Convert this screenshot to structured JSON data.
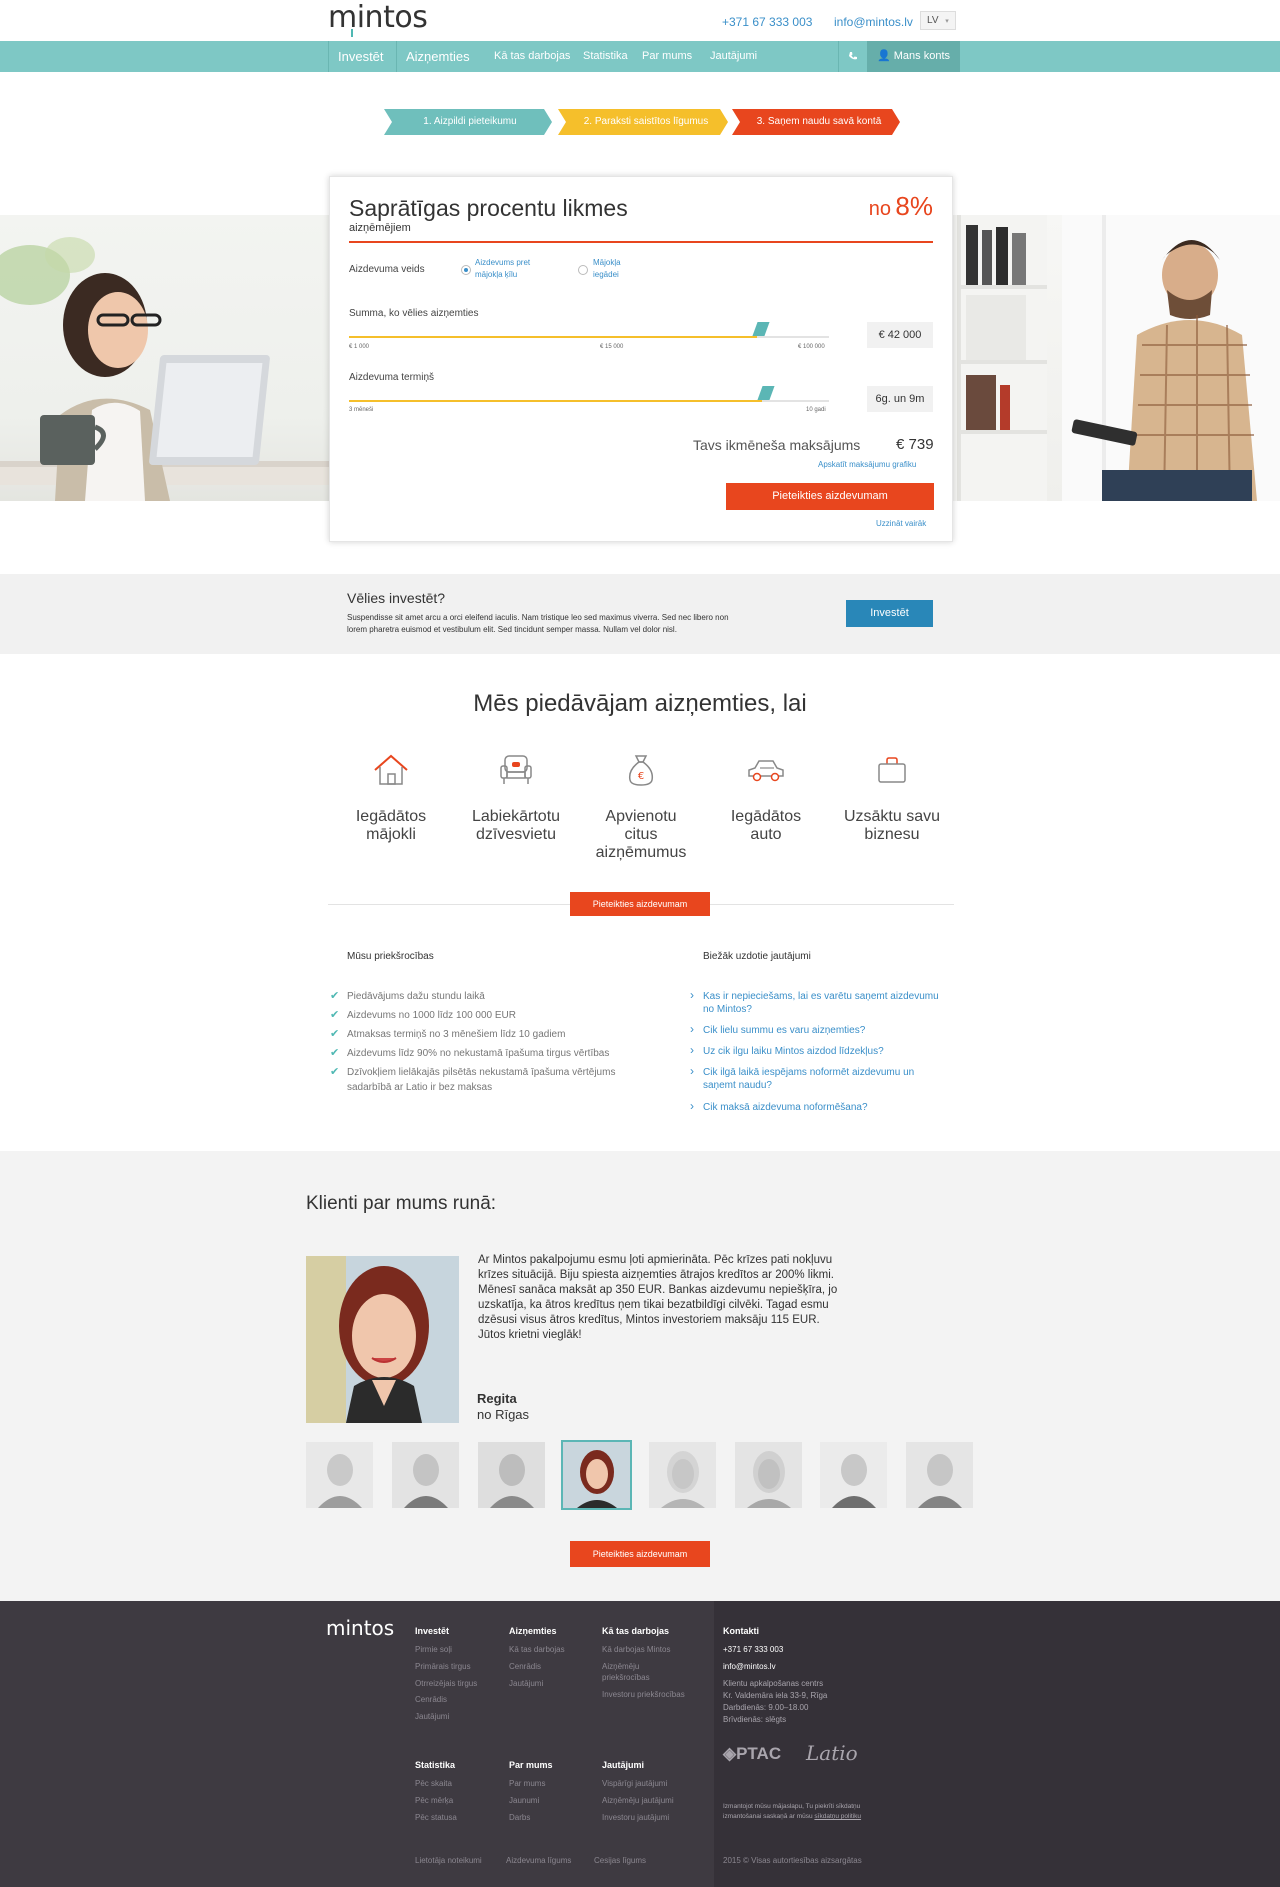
{
  "header": {
    "logo": "mintos",
    "phone": "+371 67 333 003",
    "email": "info@mintos.lv",
    "lang": "LV"
  },
  "nav": {
    "items": [
      "Investēt",
      "Aizņemties",
      "Kā tas darbojas",
      "Statistika",
      "Par mums",
      "Jautājumi"
    ],
    "account": "Mans konts"
  },
  "steps": [
    "1. Aizpildi pieteikumu",
    "2. Paraksti saistītos līgumus",
    "3. Saņem naudu savā kontā"
  ],
  "calculator": {
    "title": "Saprātīgas procentu likmes",
    "subtitle": "aizņēmējiem",
    "rate_prefix": "no",
    "rate": "8%",
    "type_label": "Aizdevuma veids",
    "type_options": [
      "Aizdevums pret mājokļa ķīlu",
      "Mājokļa iegādei"
    ],
    "amount_label": "Summa, ko vēlies aizņemties",
    "amount_ticks": [
      "€ 1 000",
      "€ 15 000",
      "€ 100 000"
    ],
    "amount_value": "€ 42 000",
    "amount_fill": 0.85,
    "term_label": "Aizdevuma termiņš",
    "term_ticks": [
      "3 mēneši",
      "10 gadi"
    ],
    "term_value": "6g. un 9m",
    "term_fill": 0.86,
    "monthly_label": "Tavs ikmēneša maksājums",
    "monthly_value": "€ 739",
    "schedule_link": "Apskatīt maksājumu grafiku",
    "apply_button": "Pieteikties aizdevumam",
    "more_link": "Uzzināt vairāk"
  },
  "invest": {
    "title": "Vēlies investēt?",
    "text_line1": "Suspendisse sit amet arcu a orci eleifend iaculis. Nam tristique leo sed maximus viverra. Sed nec libero non",
    "text_line2": "lorem pharetra euismod et vestibulum elit. Sed tincidunt semper massa. Nullam vel dolor nisl.",
    "button": "Investēt"
  },
  "offers": {
    "title": "Mēs piedāvājam aizņemties, lai",
    "items": [
      {
        "icon": "house-icon",
        "line1": "Iegādātos",
        "line2": "mājokli",
        "line3": ""
      },
      {
        "icon": "armchair-icon",
        "line1": "Labiekārtotu",
        "line2": "dzīvesvietu",
        "line3": ""
      },
      {
        "icon": "money-bag-icon",
        "line1": "Apvienotu",
        "line2": "citus",
        "line3": "aizņēmumus"
      },
      {
        "icon": "car-icon",
        "line1": "Iegādātos",
        "line2": "auto",
        "line3": ""
      },
      {
        "icon": "briefcase-icon",
        "line1": "Uzsāktu savu",
        "line2": "biznesu",
        "line3": ""
      }
    ],
    "button": "Pieteikties aizdevumam"
  },
  "advantages": {
    "title": "Mūsu priekšrocības",
    "items": [
      "Piedāvājums dažu stundu laikā",
      "Aizdevums no 1000 līdz 100 000 EUR",
      "Atmaksas termiņš no 3 mēnešiem līdz 10 gadiem",
      "Aizdevums līdz 90% no nekustamā īpašuma tirgus vērtības",
      "Dzīvokļiem lielākajās pilsētās nekustamā īpašuma vērtējums",
      "sadarbībā ar Latio ir bez maksas"
    ]
  },
  "faq": {
    "title": "Biežāk uzdotie jautājumi",
    "items": [
      "Kas ir nepieciešams, lai es varētu saņemt aizdevumu",
      "no Mintos?",
      "Cik lielu summu es varu aizņemties?",
      "Uz cik ilgu laiku Mintos aizdod līdzekļus?",
      "Cik ilgā laikā iespējams noformēt aizdevumu un",
      "saņemt naudu?",
      "Cik maksā aizdevuma noformēšana?"
    ]
  },
  "testimonials": {
    "title": "Klienti par mums runā:",
    "lines": [
      "Ar Mintos pakalpojumu esmu ļoti apmierināta. Pēc krīzes pati nokļuvu",
      "krīzes situācijā. Biju spiesta aizņemties ātrajos kredītos ar 200% likmi.",
      "Mēnesī sanāca maksāt ap 350 EUR. Bankas aizdevumu nepiešķīra, jo",
      "uzskatīja, ka ātros kredītus ņem tikai bezatbildīgi cilvēki. Tagad esmu",
      "dzēsusi visus ātros kredītus, Mintos investoriem maksāju 115 EUR.",
      "Jūtos krietni vieglāk!"
    ],
    "name": "Regita",
    "origin": "no Rīgas",
    "button": "Pieteikties aizdevumam"
  },
  "footer": {
    "logo": "mintos",
    "col1": {
      "title": "Investēt",
      "links": [
        "Pirmie soļi",
        "Primārais tirgus",
        "Otrreizējais tirgus",
        "Cenrādis",
        "Jautājumi"
      ]
    },
    "col2": {
      "title": "Aizņemties",
      "links": [
        "Kā tas darbojas",
        "Cenrādis",
        "Jautājumi"
      ]
    },
    "col3": {
      "title": "Kā tas darbojas",
      "links": [
        "Kā darbojas Mintos",
        "Aizņēmēju",
        "priekšrocības",
        "Investoru priekšrocības"
      ]
    },
    "col4": {
      "title": "Statistika",
      "links": [
        "Pēc skaita",
        "Pēc mērķa",
        "Pēc statusa"
      ]
    },
    "col5": {
      "title": "Par mums",
      "links": [
        "Par mums",
        "Jaunumi",
        "Darbs"
      ]
    },
    "col6": {
      "title": "Jautājumi",
      "links": [
        "Vispārīgi jautājumi",
        "Aizņēmēju jautājumi",
        "Investoru jautājumi"
      ]
    },
    "contacts": {
      "title": "Kontakti",
      "phone": "+371 67 333 003",
      "email": "info@mintos.lv",
      "lines": [
        "Klientu apkalpošanas centrs",
        "Kr. Valdemāra iela 33-9, Rīga",
        "Darbdienās: 9.00–18.00",
        "Brīvdienās: slēgts"
      ]
    },
    "partners": [
      "PTAC",
      "Latio"
    ],
    "cookie_line1": "Izmantojot mūsu mājaslapu, Tu piekrīti sīkdatņu",
    "cookie_line2": "izmantošanai saskaņā ar mūsu",
    "cookie_link": "sīkdatņu politiku",
    "bottom_links": [
      "Lietotāja noteikumi",
      "Aizdevuma līgums",
      "Cesijas līgums"
    ],
    "copyright": "2015 © Visas autortiesības aizsargātas"
  }
}
